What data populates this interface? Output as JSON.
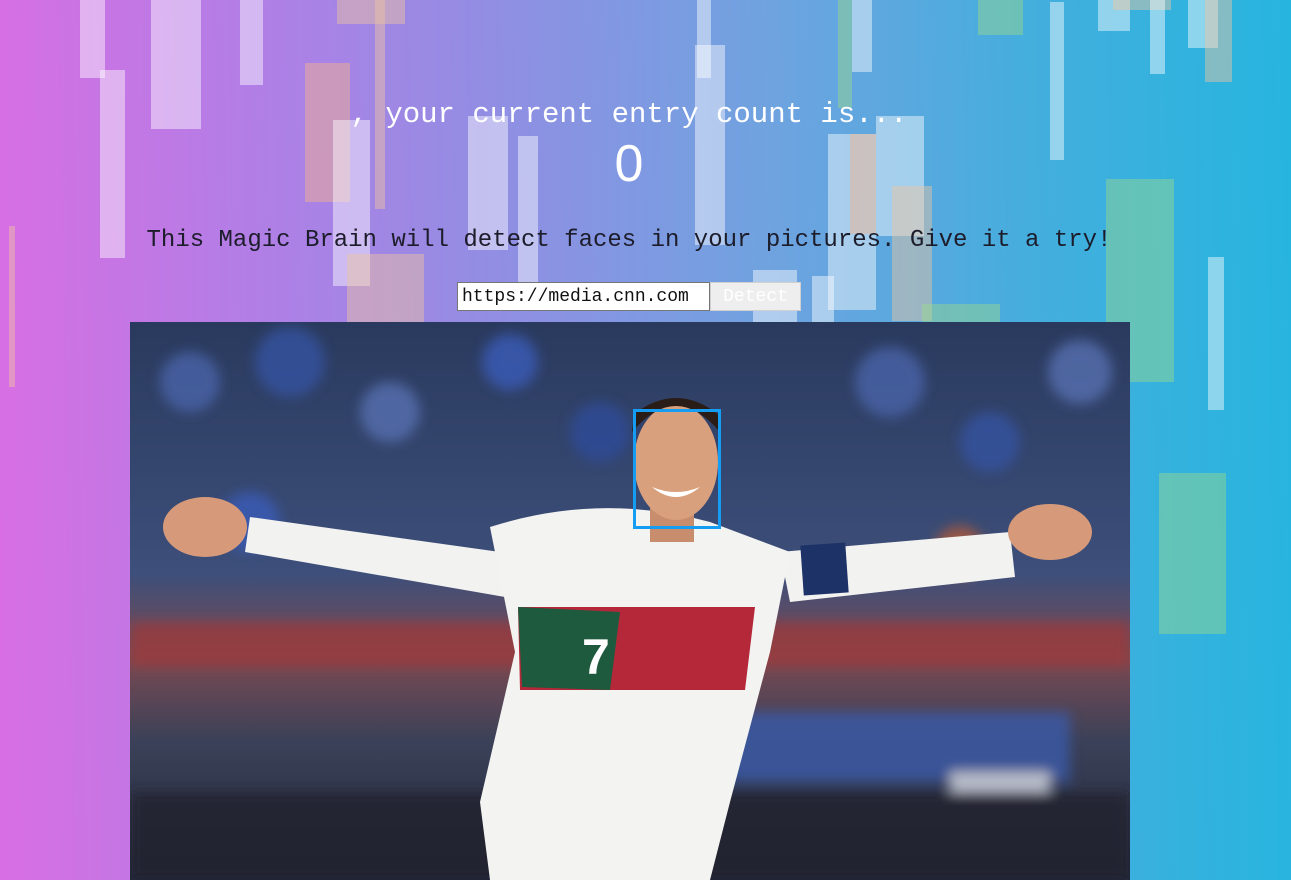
{
  "header": {
    "count_prefix": ", your current entry count is...",
    "count_value": "0"
  },
  "tagline": "This Magic Brain will detect faces in your pictures. Give it a try!",
  "form": {
    "url_value": "https://media.cnn.com",
    "detect_label": "Detect"
  },
  "photo": {
    "jersey_number": "7",
    "face_detected": true
  },
  "colors": {
    "face_box": "#149df2",
    "gradient_start": "#d86ee3",
    "gradient_end": "#26b5df"
  }
}
